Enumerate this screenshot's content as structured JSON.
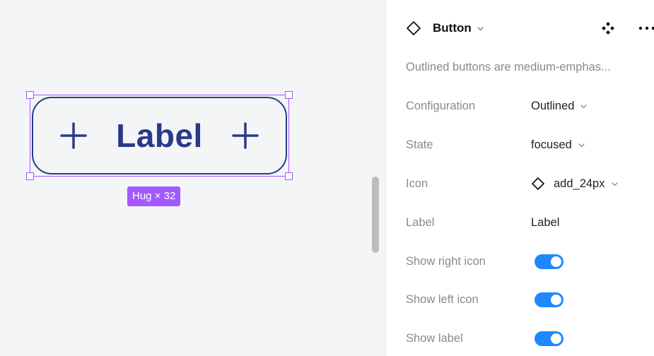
{
  "canvas": {
    "button_preview": {
      "label": "Label",
      "left_icon": "plus-icon",
      "right_icon": "plus-icon",
      "border_color": "#2b3a86"
    },
    "size_badge": "Hug × 32",
    "selection_color": "#a259ff"
  },
  "panel": {
    "component_icon": "diamond-icon",
    "component_name": "Button",
    "instance_icon": "component-instance-icon",
    "more_icon": "more-icon",
    "description": "Outlined buttons are medium-emphas...",
    "properties": [
      {
        "label": "Configuration",
        "value": "Outlined",
        "type": "dropdown"
      },
      {
        "label": "State",
        "value": "focused",
        "type": "dropdown"
      },
      {
        "label": "Icon",
        "value": "add_24px",
        "type": "instance-dropdown"
      },
      {
        "label": "Label",
        "value": "Label",
        "type": "text"
      },
      {
        "label": "Show right icon",
        "value": true,
        "type": "toggle"
      },
      {
        "label": "Show left icon",
        "value": true,
        "type": "toggle"
      },
      {
        "label": "Show label",
        "value": true,
        "type": "toggle"
      }
    ],
    "toggle_color": "#1e88ff"
  }
}
